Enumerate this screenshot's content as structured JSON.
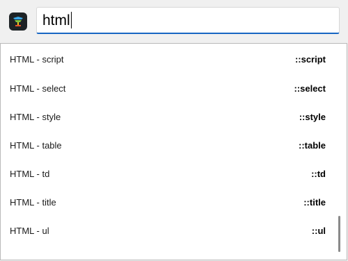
{
  "search": {
    "value": "html"
  },
  "results": [
    {
      "label": "HTML - script",
      "shortcut": "::script"
    },
    {
      "label": "HTML - select",
      "shortcut": "::select"
    },
    {
      "label": "HTML - style",
      "shortcut": "::style"
    },
    {
      "label": "HTML - table",
      "shortcut": "::table"
    },
    {
      "label": "HTML - td",
      "shortcut": "::td"
    },
    {
      "label": "HTML - title",
      "shortcut": "::title"
    },
    {
      "label": "HTML - ul",
      "shortcut": "::ul"
    }
  ],
  "icons": {
    "app": "app-logo-icon"
  },
  "colors": {
    "accent": "#1766c2",
    "icon_bg": "#1e2326"
  }
}
